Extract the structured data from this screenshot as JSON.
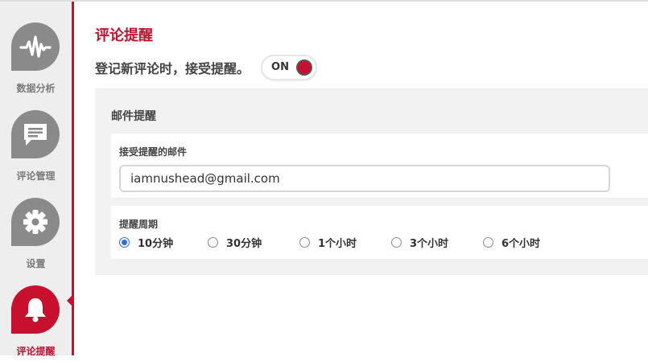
{
  "sidebar": {
    "items": [
      {
        "label": "数据分析",
        "icon": "analytics-pulse-icon",
        "active": false
      },
      {
        "label": "评论管理",
        "icon": "comment-icon",
        "active": false
      },
      {
        "label": "设置",
        "icon": "gear-icon",
        "active": false
      },
      {
        "label": "评论提醒",
        "icon": "bell-icon",
        "active": true
      }
    ]
  },
  "main": {
    "title": "评论提醒",
    "notify_text": "登记新评论时，接受提醒。",
    "toggle": {
      "label": "ON",
      "on": true
    },
    "panel": {
      "title": "邮件提醒",
      "email": {
        "label": "接受提醒的邮件",
        "value": "iamnushead@gmail.com"
      },
      "period": {
        "label": "提醒周期",
        "options": [
          "10分钟",
          "30分钟",
          "1个小时",
          "3个小时",
          "6个小时"
        ],
        "selected": "10分钟"
      }
    }
  },
  "colors": {
    "accent": "#c8102e",
    "inactive_icon": "#8a8a8a",
    "sidebar_bg": "#eeeeee",
    "panel_bg": "#f2f2f2"
  }
}
